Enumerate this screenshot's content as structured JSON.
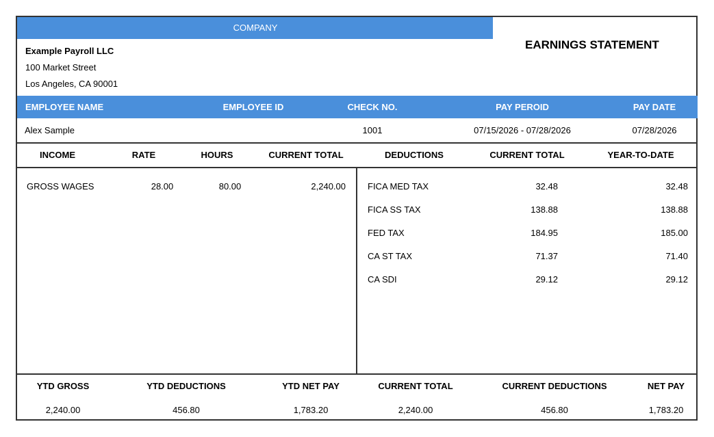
{
  "company": {
    "header_label": "COMPANY",
    "name": "Example Payroll LLC",
    "address_line1": "100 Market Street",
    "address_line2": "Los Angeles, CA 90001"
  },
  "title": "EARNINGS STATEMENT",
  "employee_header": {
    "name": "EMPLOYEE NAME",
    "id": "EMPLOYEE ID",
    "check": "CHECK NO.",
    "period": "PAY PEROID",
    "date": "PAY DATE"
  },
  "employee": {
    "name": "Alex Sample",
    "id": "",
    "check": "1001",
    "period": "07/15/2026 - 07/28/2026",
    "date": "07/28/2026"
  },
  "table_headers": {
    "income": "INCOME",
    "rate": "RATE",
    "hours": "HOURS",
    "current_total": "CURRENT TOTAL",
    "deductions": "DEDUCTIONS",
    "ded_current_total": "CURRENT TOTAL",
    "ytd": "YEAR-TO-DATE"
  },
  "income_rows": [
    {
      "label": "GROSS WAGES",
      "rate": "28.00",
      "hours": "80.00",
      "current_total": "2,240.00"
    }
  ],
  "deduction_rows": [
    {
      "label": "FICA MED TAX",
      "current": "32.48",
      "ytd": "32.48"
    },
    {
      "label": "FICA SS TAX",
      "current": "138.88",
      "ytd": "138.88"
    },
    {
      "label": "FED TAX",
      "current": "184.95",
      "ytd": "185.00"
    },
    {
      "label": "CA ST TAX",
      "current": "71.37",
      "ytd": "71.40"
    },
    {
      "label": "CA SDI",
      "current": "29.12",
      "ytd": "29.12"
    }
  ],
  "summary_headers": {
    "ytd_gross": "YTD GROSS",
    "ytd_deductions": "YTD DEDUCTIONS",
    "ytd_net_pay": "YTD NET PAY",
    "current_total": "CURRENT TOTAL",
    "current_deductions": "CURRENT DEDUCTIONS",
    "net_pay": "NET PAY"
  },
  "summary_values": {
    "ytd_gross": "2,240.00",
    "ytd_deductions": "456.80",
    "ytd_net_pay": "1,783.20",
    "current_total": "2,240.00",
    "current_deductions": "456.80",
    "net_pay": "1,783.20"
  },
  "colors": {
    "header_blue": "#4a8fdb",
    "border": "#333333"
  }
}
